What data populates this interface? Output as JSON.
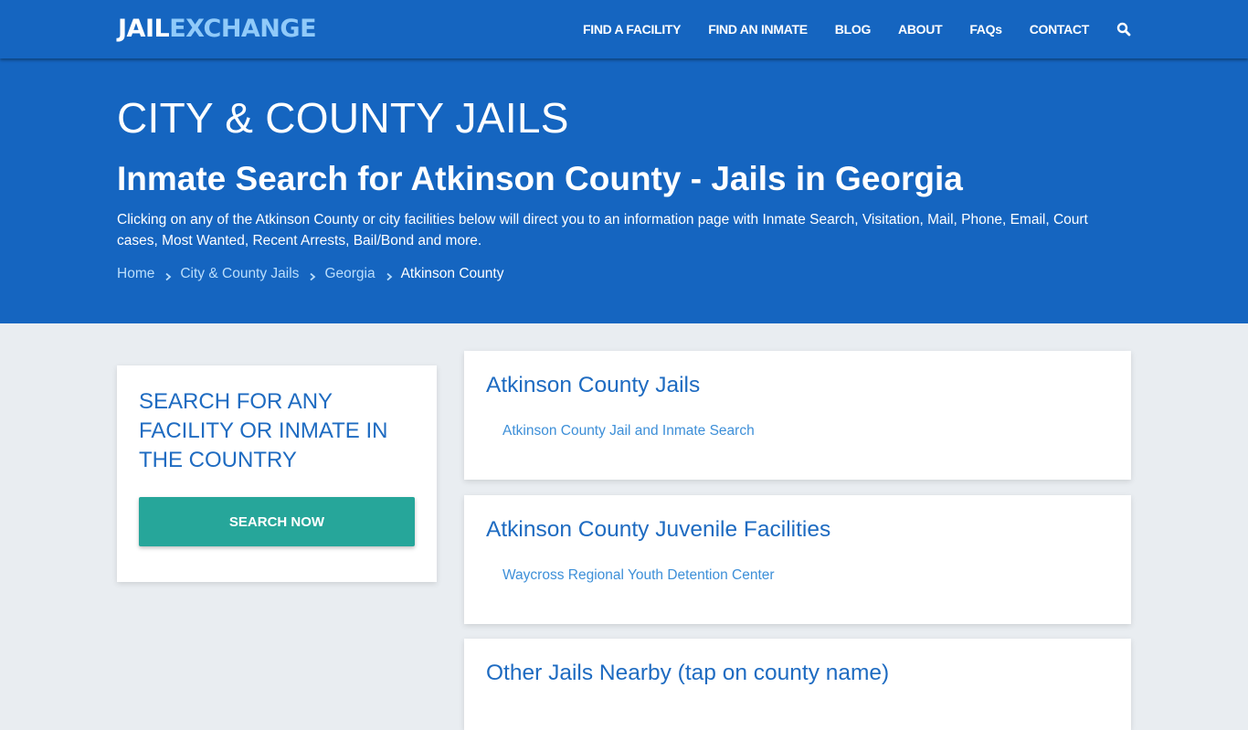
{
  "navbar": {
    "logo_part1": "JAIL",
    "logo_part2": "EXCHANGE",
    "menu": [
      {
        "label": "FIND A FACILITY"
      },
      {
        "label": "FIND AN INMATE"
      },
      {
        "label": "BLOG"
      },
      {
        "label": "ABOUT"
      },
      {
        "label": "FAQs"
      },
      {
        "label": "CONTACT"
      }
    ],
    "search_icon": "search-icon"
  },
  "hero": {
    "title": "CITY & COUNTY JAILS",
    "subtitle": "Inmate Search for Atkinson County - Jails in Georgia",
    "description": "Clicking on any of the Atkinson County or city facilities below will direct you to an information page with Inmate Search, Visitation, Mail, Phone, Email, Court cases, Most Wanted, Recent Arrests, Bail/Bond and more.",
    "breadcrumb": [
      {
        "label": "Home"
      },
      {
        "label": "City & County Jails"
      },
      {
        "label": "Georgia"
      },
      {
        "label": "Atkinson County"
      }
    ]
  },
  "sidebar": {
    "title": "SEARCH FOR ANY FACILITY OR INMATE IN THE COUNTRY",
    "button_label": "SEARCH NOW"
  },
  "sections": [
    {
      "title": "Atkinson County Jails",
      "links": [
        {
          "label": "Atkinson County Jail and Inmate Search"
        }
      ]
    },
    {
      "title": "Atkinson County Juvenile Facilities",
      "links": [
        {
          "label": "Waycross Regional Youth Detention Center"
        }
      ]
    },
    {
      "title": "Other Jails Nearby (tap on county name)",
      "links": []
    }
  ],
  "colors": {
    "brand_blue": "#1565c0",
    "logo_accent": "#90caf9",
    "heading_blue": "#1e6bc1",
    "link_blue": "#3d8fd8",
    "button_teal": "#26a69a",
    "page_bg": "#e9edf1"
  }
}
